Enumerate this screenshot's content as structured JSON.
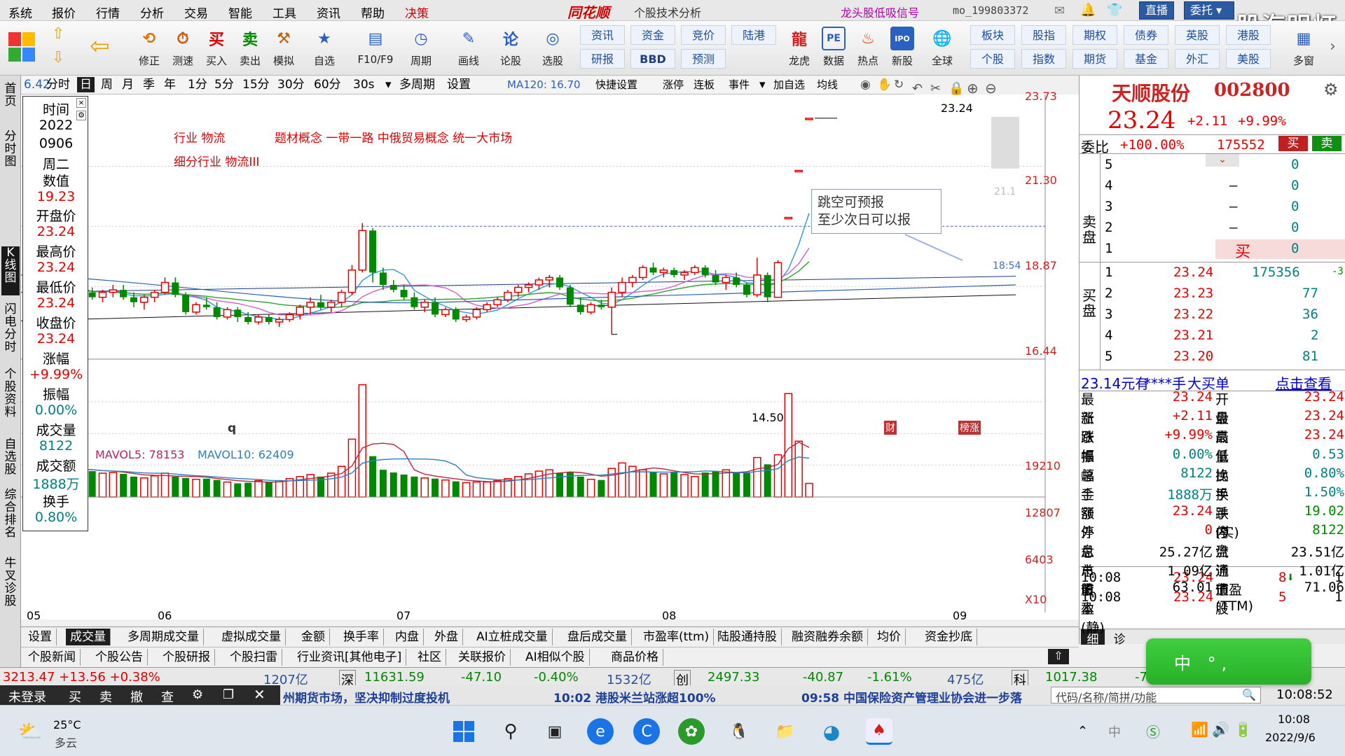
{
  "menu": {
    "items": [
      "系统",
      "报价",
      "行情",
      "分析",
      "交易",
      "智能",
      "工具",
      "资讯",
      "帮助"
    ],
    "highlight": "决策",
    "brand": "同花顺",
    "window_title": "个股技术分析",
    "signal": "龙头股低吸信号",
    "user": "mo_199803372",
    "live_btn": "直播",
    "trust_btn": "委托"
  },
  "watermark": "股海明灯",
  "toolbar": {
    "icons": [
      {
        "label": "修正",
        "icon": "refresh-icon"
      },
      {
        "label": "测速",
        "icon": "clock-icon"
      },
      {
        "label": "买入",
        "icon": "buy-icon",
        "glyph": "买"
      },
      {
        "label": "卖出",
        "icon": "sell-icon",
        "glyph": "卖"
      },
      {
        "label": "模拟",
        "icon": "hammer-icon"
      },
      {
        "label": "自选",
        "icon": "star-icon"
      },
      {
        "label": "F10/F9",
        "icon": "f10-icon"
      },
      {
        "label": "周期",
        "icon": "cycle-icon"
      },
      {
        "label": "画线",
        "icon": "pen-icon"
      },
      {
        "label": "论股",
        "icon": "discuss-icon",
        "glyph": "论"
      },
      {
        "label": "选股",
        "icon": "select-icon"
      }
    ],
    "text_buttons_top": [
      "资讯",
      "资金",
      "竞价",
      "陆港"
    ],
    "text_buttons_bottom": [
      "研报",
      "BBD",
      "预测"
    ],
    "right_icons": [
      {
        "label": "龙虎",
        "icon": "dragon-icon"
      },
      {
        "label": "数据",
        "icon": "pe-icon",
        "glyph": "PE"
      },
      {
        "label": "热点",
        "icon": "hot-icon"
      },
      {
        "label": "新股",
        "icon": "ipo-icon",
        "glyph": "IPO"
      },
      {
        "label": "全球",
        "icon": "globe-icon"
      }
    ],
    "right_text_top": [
      "板块",
      "股指",
      "期权",
      "债券",
      "英股",
      "港股"
    ],
    "right_text_bottom": [
      "个股",
      "指数",
      "期货",
      "基金",
      "外汇",
      "美股"
    ],
    "more": "多窗"
  },
  "vtabs": [
    "首页",
    "分时图",
    "K线图",
    "闪电分时",
    "个股资料",
    "自选股",
    "综合排名",
    "牛叉诊股"
  ],
  "periods": [
    "分时",
    "日",
    "周",
    "月",
    "季",
    "年",
    "1分",
    "5分",
    "15分",
    "30分",
    "60分",
    "30s",
    "多周期",
    "设置"
  ],
  "ma_line": "MA120: 16.70",
  "ma_trunc": "6.42",
  "chart_tools": [
    "快捷设置",
    "涨停",
    "连板",
    "事件",
    "加自选",
    "均线"
  ],
  "info_panel": [
    {
      "label": "时间",
      "value": "2022"
    },
    {
      "label": "",
      "value": "0906"
    },
    {
      "label": "",
      "value": "周二"
    },
    {
      "label": "数值",
      "value": "19.23"
    },
    {
      "label": "开盘价",
      "value": "23.24"
    },
    {
      "label": "最高价",
      "value": "23.24"
    },
    {
      "label": "最低价",
      "value": "23.24"
    },
    {
      "label": "收盘价",
      "value": "23.24"
    },
    {
      "label": "涨幅",
      "value": "+9.99%"
    },
    {
      "label": "振幅",
      "value": "0.00%"
    },
    {
      "label": "成交量",
      "value": "8122"
    },
    {
      "label": "成交额",
      "value": "1888万"
    },
    {
      "label": "换手",
      "value": "0.80%"
    }
  ],
  "annotations": {
    "industry": "行业  物流",
    "concept": "题材概念  一带一路  中俄贸易概念  统一大市场",
    "sub_industry": "细分行业  物流III",
    "tip_line1": "跳空可预报",
    "tip_line2": "至少次日可以报",
    "high_label": "23.24",
    "low_label": "14.50",
    "time_label": "18:54",
    "price_label": "21.1",
    "marker_q": "q",
    "marker_cai": "财",
    "marker_bang": "榜涨"
  },
  "price_axis": [
    "23.73",
    "21.30",
    "18.87",
    "16.44"
  ],
  "vol_axis": [
    "19210",
    "12807",
    "6403",
    "X10"
  ],
  "date_axis": [
    "05",
    "06",
    "07",
    "08",
    "09"
  ],
  "volume_legend": {
    "mavol5": "MAVOL5: 78153",
    "mavol10": "MAVOL10: 62409"
  },
  "quote": {
    "name": "天顺股份",
    "code": "002800",
    "price": "23.24",
    "change": "+2.11",
    "pct": "+9.99%",
    "webi_label": "委比",
    "webi": "+100.00%",
    "webi_diff": "175552",
    "buy_btn": "买",
    "sell_btn": "卖",
    "sell_levels": [
      {
        "lv": "5",
        "price": "",
        "vol": "0"
      },
      {
        "lv": "4",
        "price": "—",
        "vol": "0"
      },
      {
        "lv": "3",
        "price": "—",
        "vol": "0"
      },
      {
        "lv": "2",
        "price": "—",
        "vol": "0"
      },
      {
        "lv": "1",
        "price": "买",
        "vol": "0"
      }
    ],
    "buy_levels": [
      {
        "lv": "1",
        "price": "23.24",
        "vol": "175356",
        "chg": "-3"
      },
      {
        "lv": "2",
        "price": "23.23",
        "vol": "77",
        "chg": ""
      },
      {
        "lv": "3",
        "price": "23.22",
        "vol": "36",
        "chg": ""
      },
      {
        "lv": "4",
        "price": "23.21",
        "vol": "2",
        "chg": ""
      },
      {
        "lv": "5",
        "price": "23.20",
        "vol": "81",
        "chg": ""
      }
    ],
    "sell_side_label": "卖盘",
    "buy_side_label": "买盘",
    "big_order_price": "23.14元有",
    "big_order_mask": "****手",
    "big_order_label": "大买单",
    "big_order_link": "点击查看",
    "stats_left": [
      {
        "k": "最新",
        "v": "23.24"
      },
      {
        "k": "涨跌",
        "v": "+2.11"
      },
      {
        "k": "涨幅",
        "v": "+9.99%"
      },
      {
        "k": "振幅",
        "v": "0.00%"
      },
      {
        "k": "总手",
        "v": "8122"
      },
      {
        "k": "金额",
        "v": "1888万"
      },
      {
        "k": "涨停",
        "v": "23.24"
      },
      {
        "k": "外盘",
        "v": "0"
      },
      {
        "k": "总市值",
        "v": "25.27亿"
      },
      {
        "k": "总股本",
        "v": "1.09亿"
      },
      {
        "k": "市盈(静)",
        "v": "63.01"
      }
    ],
    "stats_right": [
      {
        "k": "开盘",
        "v": "23.24"
      },
      {
        "k": "最高",
        "v": "23.24"
      },
      {
        "k": "最低",
        "v": "23.24"
      },
      {
        "k": "量比",
        "v": "0.53"
      },
      {
        "k": "换手",
        "v": "0.80%"
      },
      {
        "k": "换手(实)",
        "v": "1.50%"
      },
      {
        "k": "跌停",
        "v": "19.02"
      },
      {
        "k": "内盘",
        "v": "8122"
      },
      {
        "k": "流通值",
        "v": "23.51亿"
      },
      {
        "k": "流通股",
        "v": "1.01亿"
      },
      {
        "k": "市盈(TTM)",
        "v": "71.06"
      }
    ],
    "ticks": [
      {
        "t": "10:08",
        "p": "23.24",
        "v": "8",
        "n": "1"
      },
      {
        "t": "10:08",
        "p": "23.24",
        "v": "5",
        "n": "1"
      }
    ],
    "tab_detail": "细",
    "tab_diag": "诊"
  },
  "ime_popup": "中 °,",
  "bottom_tabs1": [
    "设置",
    "成交量",
    "多周期成交量",
    "虚拟成交量",
    "金额",
    "换手率",
    "内盘",
    "外盘",
    "AI立桩成交量",
    "盘后成交量",
    "市盈率(ttm)",
    "陆股通持股",
    "融资融券余额",
    "均价",
    "资金抄底"
  ],
  "bottom_tabs2": [
    "个股新闻",
    "个股公告",
    "个股研报",
    "个股扫雷",
    "行业资讯[其他电子]",
    "社区",
    "关联报价",
    "AI相似个股",
    "商品价格"
  ],
  "index_bar": {
    "sh_trunc": "3213.47 +13.56 +0.38%",
    "sh_amt": "1207亿",
    "sz_label": "深",
    "sz_val": "11631.59",
    "sz_chg": "-47.10",
    "sz_pct": "-0.40%",
    "sz_amt": "1532亿",
    "cy_label": "创",
    "cy_val": "2497.33",
    "cy_chg": "-40.87",
    "cy_pct": "-1.61%",
    "cy_amt": "475亿",
    "kc_label": "科",
    "kc_val": "1017.38",
    "kc_chg": "-7"
  },
  "trade_bar": [
    "未登录",
    "买",
    "卖",
    "撤",
    "查"
  ],
  "news": [
    "州期货市场，坚决抑制过度投机",
    "10:02 港股米兰站涨超100%",
    "09:58 中国保险资产管理业协会进一步落"
  ],
  "search_placeholder": "代码/名称/简拼/功能",
  "clock": "10:08:52",
  "weather": {
    "temp": "25°C",
    "desc": "多云"
  },
  "sys_time": "10:08",
  "sys_date": "2022/9/6",
  "tray_ime": "中",
  "colors": {
    "up": "#e60000",
    "down": "#008800",
    "accent": "#2c5aa0"
  },
  "chart_data": {
    "type": "candlestick",
    "title": "天顺股份 002800",
    "ylim": [
      13.5,
      24.2
    ],
    "candles": [
      [
        16.3,
        16.6,
        16.0,
        16.5
      ],
      [
        16.5,
        16.7,
        16.1,
        16.2
      ],
      [
        16.2,
        16.4,
        15.9,
        16.0
      ],
      [
        16.0,
        16.3,
        15.8,
        16.2
      ],
      [
        16.2,
        16.5,
        16.0,
        16.3
      ],
      [
        16.3,
        16.5,
        15.9,
        16.0
      ],
      [
        16.0,
        16.2,
        15.6,
        15.8
      ],
      [
        15.8,
        16.1,
        15.5,
        16.0
      ],
      [
        16.0,
        16.3,
        15.8,
        16.2
      ],
      [
        16.2,
        16.8,
        16.1,
        16.6
      ],
      [
        16.6,
        16.8,
        16.0,
        16.1
      ],
      [
        16.1,
        16.2,
        15.3,
        15.4
      ],
      [
        15.4,
        15.8,
        15.3,
        15.7
      ],
      [
        15.7,
        16.0,
        15.5,
        15.6
      ],
      [
        15.6,
        15.8,
        15.1,
        15.2
      ],
      [
        15.2,
        15.6,
        15.1,
        15.5
      ],
      [
        15.5,
        15.6,
        15.0,
        15.2
      ],
      [
        15.2,
        15.4,
        14.9,
        15.0
      ],
      [
        15.0,
        15.3,
        14.9,
        15.2
      ],
      [
        15.2,
        15.3,
        14.9,
        15.0
      ],
      [
        15.0,
        15.2,
        14.8,
        15.1
      ],
      [
        15.1,
        15.4,
        15.0,
        15.3
      ],
      [
        15.3,
        15.7,
        15.1,
        15.6
      ],
      [
        15.6,
        16.0,
        15.3,
        15.8
      ],
      [
        15.8,
        16.1,
        15.5,
        15.6
      ],
      [
        15.6,
        15.9,
        15.4,
        15.8
      ],
      [
        15.8,
        16.3,
        15.6,
        16.2
      ],
      [
        16.2,
        17.3,
        16.1,
        17.1
      ],
      [
        17.1,
        19.0,
        17.0,
        18.7
      ],
      [
        18.7,
        18.8,
        16.6,
        17.0
      ],
      [
        17.0,
        17.2,
        16.3,
        16.5
      ],
      [
        16.5,
        16.7,
        16.2,
        16.3
      ],
      [
        16.3,
        16.5,
        15.9,
        16.0
      ],
      [
        16.0,
        16.2,
        15.5,
        15.6
      ],
      [
        15.6,
        15.9,
        15.4,
        15.8
      ],
      [
        15.8,
        16.0,
        15.2,
        15.3
      ],
      [
        15.3,
        15.6,
        15.2,
        15.5
      ],
      [
        15.5,
        15.6,
        15.0,
        15.1
      ],
      [
        15.1,
        15.3,
        15.0,
        15.2
      ],
      [
        15.2,
        15.6,
        15.1,
        15.5
      ],
      [
        15.5,
        15.8,
        15.4,
        15.7
      ],
      [
        15.7,
        16.0,
        15.6,
        15.9
      ],
      [
        15.9,
        16.3,
        15.8,
        16.2
      ],
      [
        16.2,
        16.5,
        16.0,
        16.4
      ],
      [
        16.4,
        16.6,
        16.2,
        16.5
      ],
      [
        16.5,
        16.8,
        16.3,
        16.7
      ],
      [
        16.7,
        16.9,
        16.4,
        16.8
      ],
      [
        16.8,
        16.9,
        16.3,
        16.4
      ],
      [
        16.4,
        16.5,
        15.6,
        15.7
      ],
      [
        15.7,
        16.0,
        15.3,
        15.4
      ],
      [
        15.4,
        15.8,
        15.3,
        15.7
      ],
      [
        15.7,
        15.9,
        15.5,
        15.6
      ],
      [
        15.6,
        16.4,
        14.5,
        16.2
      ],
      [
        16.2,
        16.8,
        16.0,
        16.6
      ],
      [
        16.6,
        16.9,
        16.4,
        16.8
      ],
      [
        16.8,
        17.3,
        16.7,
        17.2
      ],
      [
        17.2,
        17.4,
        16.9,
        17.0
      ],
      [
        17.0,
        17.2,
        16.8,
        17.1
      ],
      [
        17.1,
        17.2,
        16.8,
        16.9
      ],
      [
        16.9,
        17.1,
        16.7,
        17.0
      ],
      [
        17.0,
        17.3,
        16.9,
        17.2
      ],
      [
        17.2,
        17.3,
        16.8,
        16.9
      ],
      [
        16.9,
        17.1,
        16.5,
        16.6
      ],
      [
        16.6,
        16.9,
        16.3,
        16.8
      ],
      [
        16.8,
        17.0,
        16.4,
        16.5
      ],
      [
        16.5,
        16.6,
        16.0,
        16.1
      ],
      [
        16.1,
        17.6,
        16.0,
        16.9
      ],
      [
        16.9,
        17.0,
        15.8,
        16.0
      ],
      [
        16.0,
        17.5,
        16.0,
        17.4
      ],
      [
        19.23,
        19.23,
        19.23,
        19.23
      ],
      [
        21.13,
        21.13,
        21.13,
        21.13
      ],
      [
        23.24,
        23.24,
        23.24,
        23.24
      ]
    ],
    "volumes": [
      42,
      40,
      38,
      35,
      36,
      34,
      30,
      28,
      31,
      35,
      30,
      28,
      26,
      27,
      25,
      22,
      20,
      21,
      24,
      22,
      24,
      27,
      30,
      33,
      30,
      35,
      45,
      85,
      165,
      60,
      40,
      36,
      33,
      30,
      28,
      27,
      25,
      23,
      21,
      22,
      22,
      24,
      27,
      30,
      34,
      38,
      40,
      35,
      37,
      30,
      26,
      25,
      42,
      50,
      45,
      40,
      37,
      34,
      36,
      33,
      30,
      36,
      38,
      40,
      36,
      35,
      58,
      48,
      62,
      152,
      82,
      20
    ]
  }
}
